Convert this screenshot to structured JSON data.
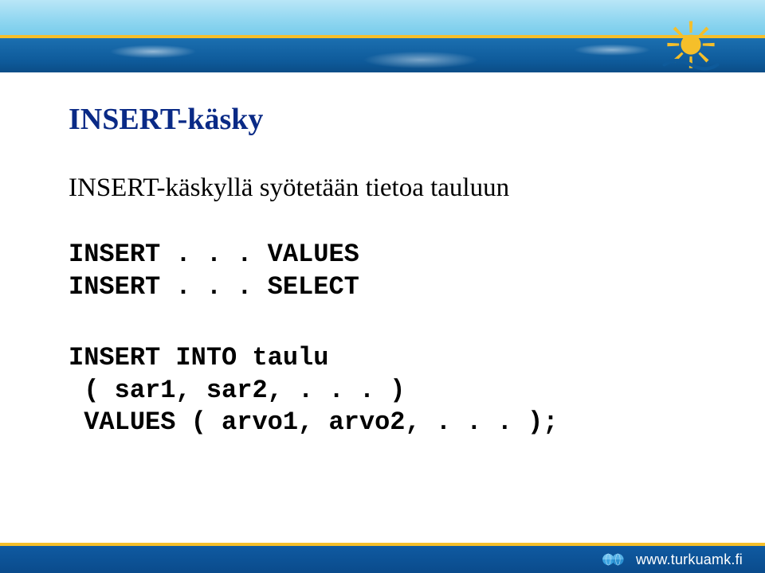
{
  "title": "INSERT-käsky",
  "subtitle": "INSERT-käskyllä syötetään tietoa tauluun",
  "code_variants": "INSERT . . . VALUES\nINSERT . . . SELECT",
  "code_syntax": "INSERT INTO taulu\n ( sar1, sar2, . . . )\n VALUES ( arvo1, arvo2, . . . );",
  "footer_url": "www.turkuamk.fi",
  "colors": {
    "title": "#0a2a86",
    "accent": "#f5bf2a",
    "water": "#0e5a9a",
    "sky": "#8fd6f0"
  }
}
